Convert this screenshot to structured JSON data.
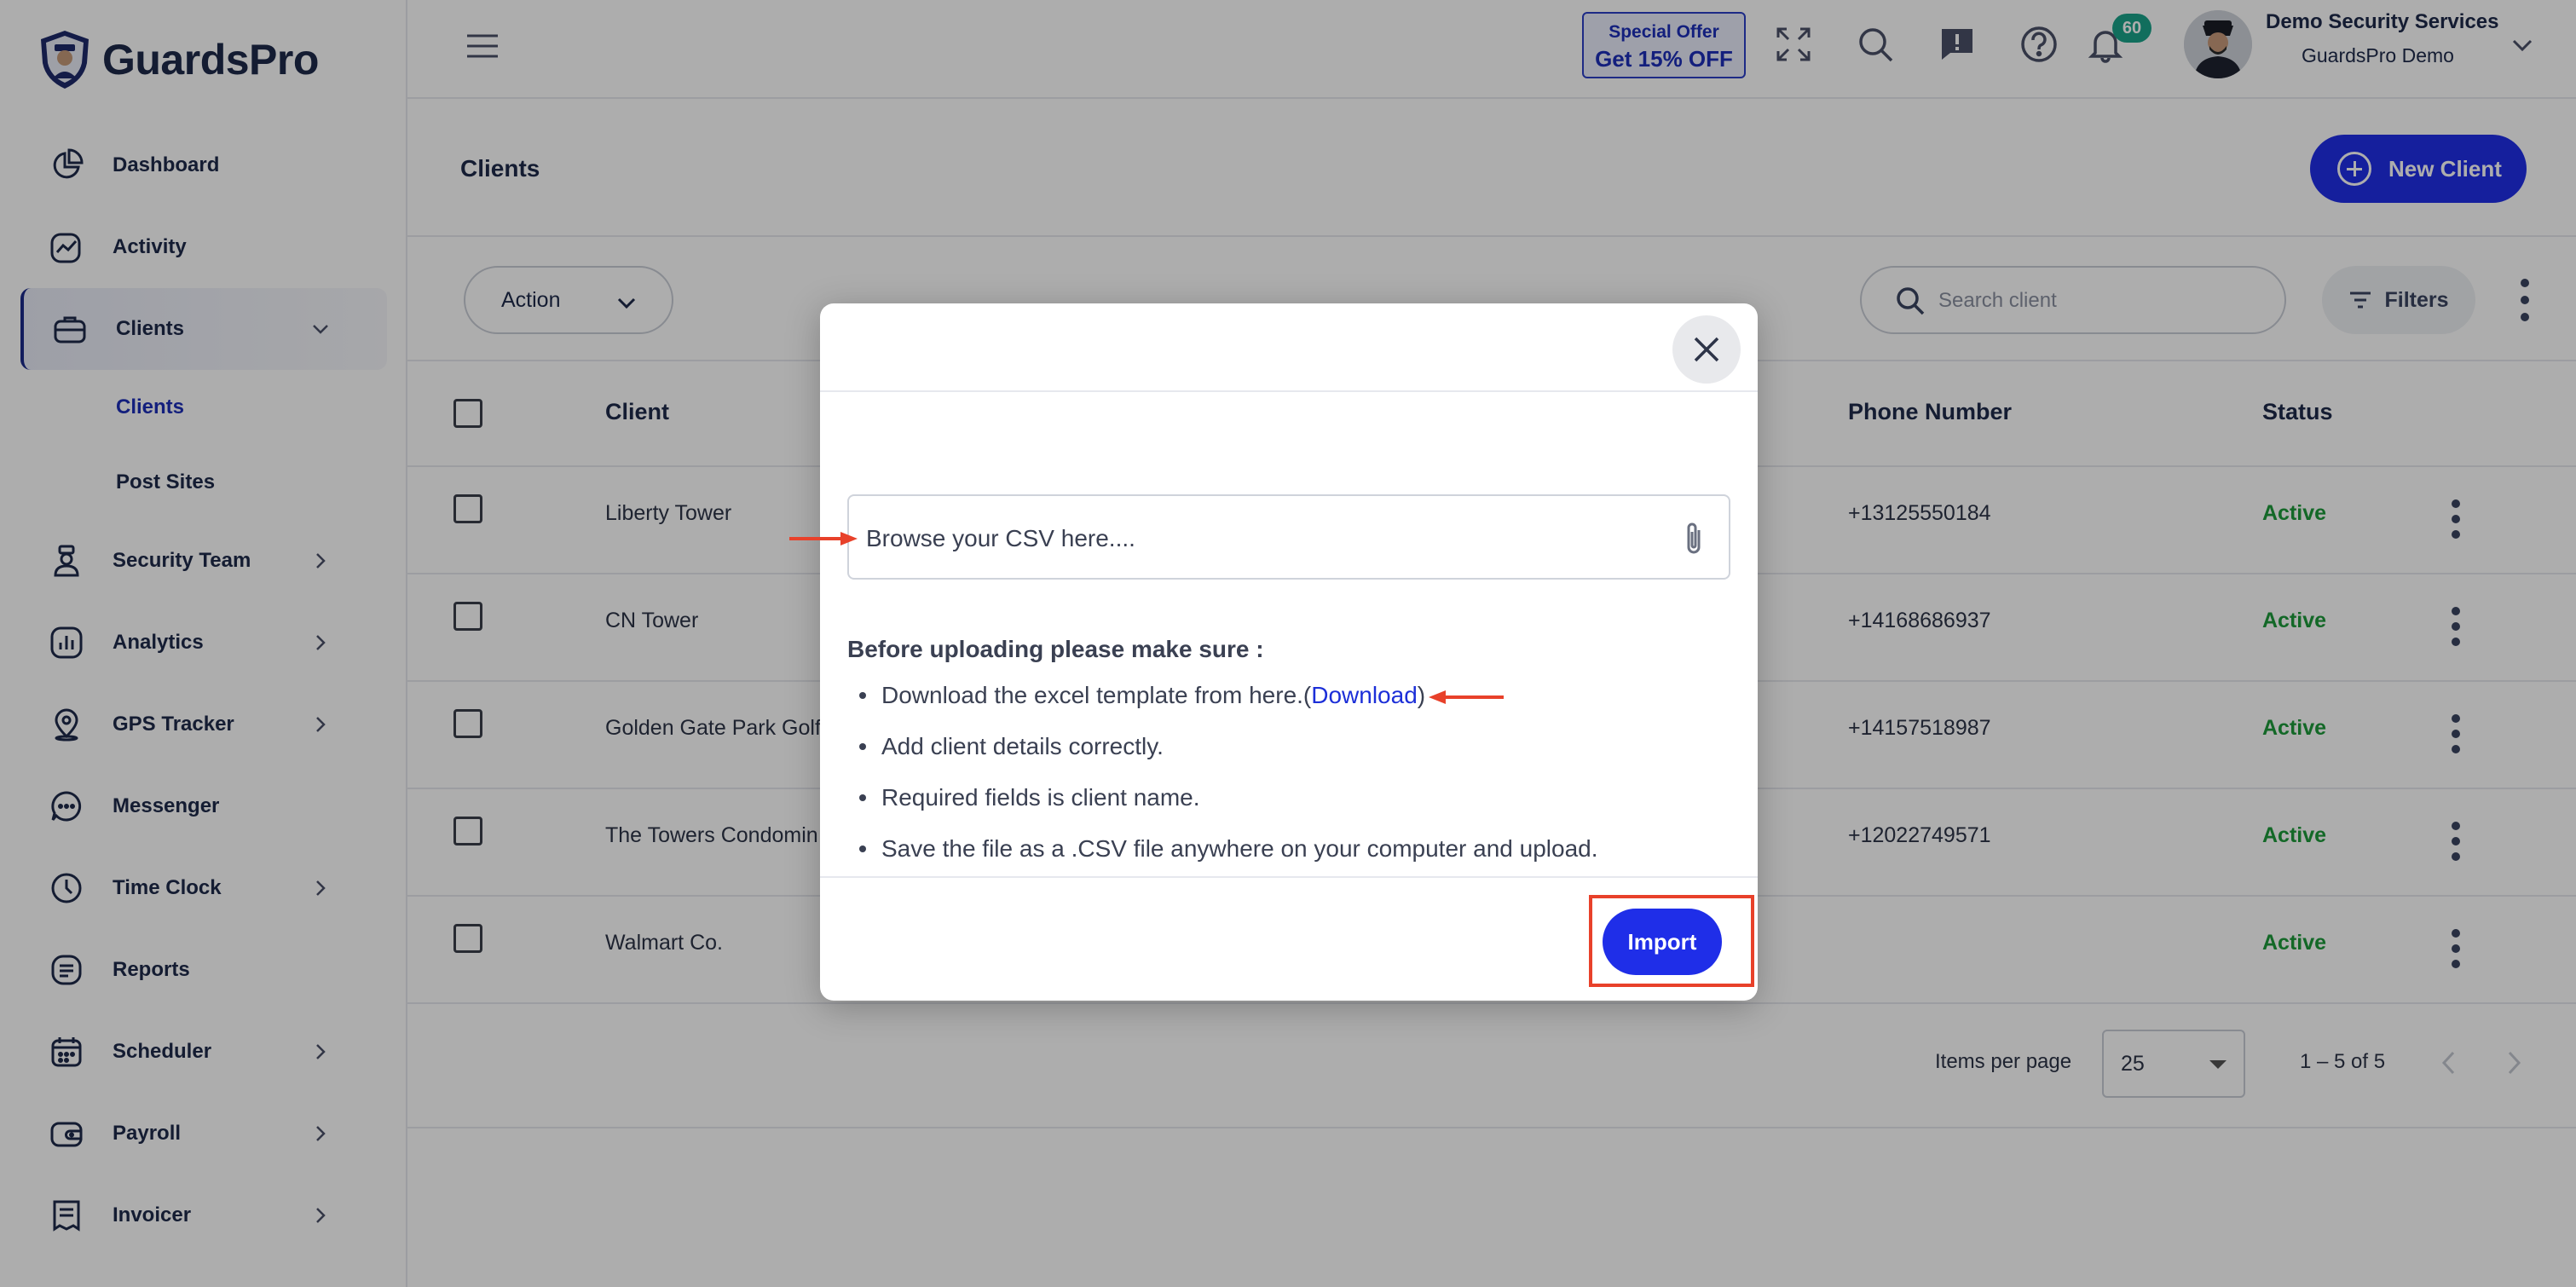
{
  "brand": {
    "name": "GuardsPro"
  },
  "sidebar": {
    "items": [
      {
        "label": "Dashboard",
        "icon": "pie-chart-icon"
      },
      {
        "label": "Activity",
        "icon": "activity-chart-icon"
      },
      {
        "label": "Clients",
        "icon": "briefcase-icon",
        "expanded": true
      },
      {
        "label": "Security Team",
        "icon": "guard-icon"
      },
      {
        "label": "Analytics",
        "icon": "bar-chart-icon"
      },
      {
        "label": "GPS Tracker",
        "icon": "location-pin-icon"
      },
      {
        "label": "Messenger",
        "icon": "chat-bubble-icon"
      },
      {
        "label": "Time Clock",
        "icon": "clock-icon"
      },
      {
        "label": "Reports",
        "icon": "document-list-icon"
      },
      {
        "label": "Scheduler",
        "icon": "calendar-icon"
      },
      {
        "label": "Payroll",
        "icon": "wallet-icon"
      },
      {
        "label": "Invoicer",
        "icon": "invoice-icon"
      }
    ],
    "sub_items": [
      {
        "label": "Clients",
        "active": true
      },
      {
        "label": "Post Sites",
        "active": false
      }
    ]
  },
  "topbar": {
    "offer_line1": "Special Offer",
    "offer_line2": "Get 15% OFF",
    "notifications_count": "60",
    "user_name": "Demo Security Services",
    "user_org": "GuardsPro Demo"
  },
  "page": {
    "title": "Clients",
    "new_client_label": "New Client"
  },
  "toolbar": {
    "action_label": "Action",
    "search_placeholder": "Search client",
    "filters_label": "Filters"
  },
  "table": {
    "headers": {
      "client": "Client",
      "phone": "Phone Number",
      "status": "Status"
    },
    "rows": [
      {
        "client": "Liberty Tower",
        "phone": "+13125550184",
        "status": "Active"
      },
      {
        "client": "CN Tower",
        "phone": "+14168686937",
        "status": "Active"
      },
      {
        "client": "Golden Gate Park Golf",
        "phone": "+14157518987",
        "status": "Active"
      },
      {
        "client": "The Towers Condomin",
        "phone": "+12022749571",
        "status": "Active"
      },
      {
        "client": "Walmart Co.",
        "phone": "",
        "status": "Active"
      }
    ]
  },
  "pagination": {
    "items_per_page_label": "Items per page",
    "items_per_page_value": "25",
    "range_label": "1 – 5 of 5"
  },
  "modal": {
    "file_placeholder": "Browse your CSV here....",
    "instructions_title": "Before uploading please make sure :",
    "instruction_1_text": "Download the excel template from here.(",
    "instruction_1_link": "Download",
    "instruction_1_close": ")",
    "instruction_2": "Add client details correctly.",
    "instruction_3": "Required fields is client name.",
    "instruction_4": "Save the file as a .CSV file anywhere on your computer and upload.",
    "import_label": "Import"
  },
  "colors": {
    "primary": "#1f2ee8",
    "active_status": "#1d9a3a",
    "annotation": "#e8412a",
    "badge": "#1aa38a"
  }
}
